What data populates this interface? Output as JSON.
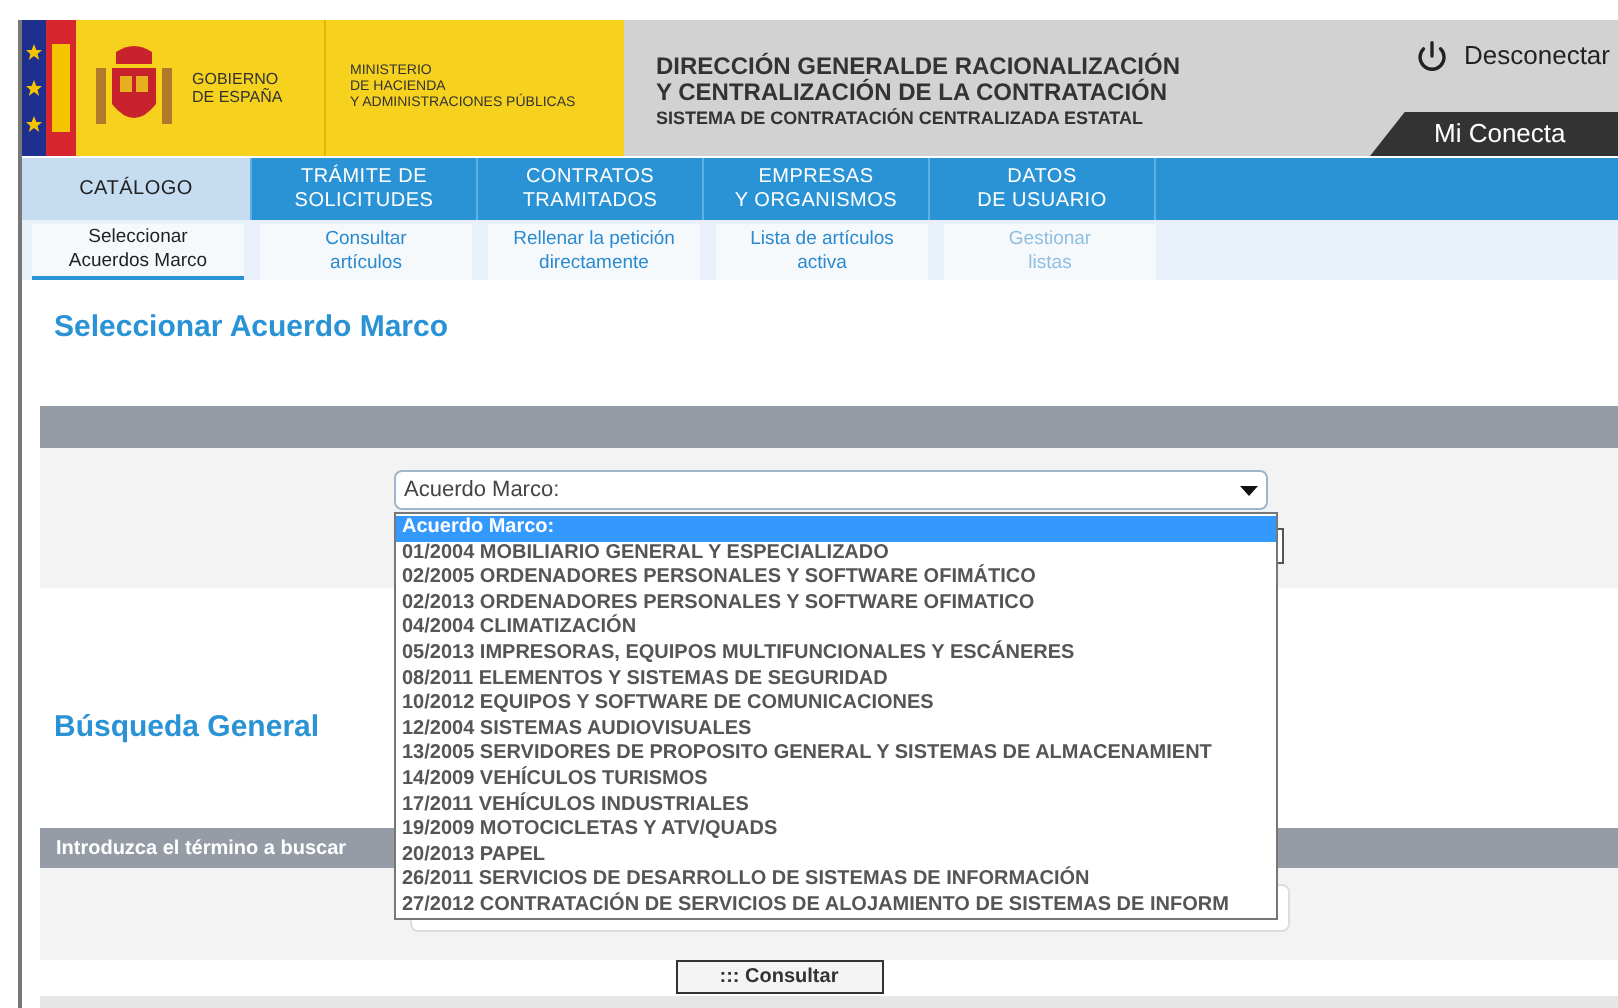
{
  "header": {
    "government": "GOBIERNO\nDE ESPAÑA",
    "ministry": "MINISTERIO\nDE HACIENDA\nY ADMINISTRACIONES PÚBLICAS",
    "title_lines": [
      "DIRECCIÓN GENERALDE RACIONALIZACIÓN",
      "Y CENTRALIZACIÓN DE LA CONTRATACIÓN"
    ],
    "subtitle": "SISTEMA DE CONTRATACIÓN CENTRALIZADA ESTATAL",
    "logout": "Desconectar",
    "account_tab": "Mi Conecta"
  },
  "main_tabs": [
    {
      "label": "CATÁLOGO",
      "selected": true
    },
    {
      "label": "TRÁMITE DE\nSOLICITUDES",
      "selected": false
    },
    {
      "label": "CONTRATOS\nTRAMITADOS",
      "selected": false
    },
    {
      "label": "EMPRESAS\nY ORGANISMOS",
      "selected": false
    },
    {
      "label": "DATOS\nDE USUARIO",
      "selected": false
    }
  ],
  "sub_tabs": [
    {
      "label": "Seleccionar\nAcuerdos Marco",
      "selected": true,
      "disabled": false
    },
    {
      "label": "Consultar\nartículos",
      "selected": false,
      "disabled": false
    },
    {
      "label": "Rellenar la petición\ndirectamente",
      "selected": false,
      "disabled": false
    },
    {
      "label": "Lista de artículos\nactiva",
      "selected": false,
      "disabled": false
    },
    {
      "label": "Gestionar\nlistas",
      "selected": false,
      "disabled": true
    }
  ],
  "select_section": {
    "title": "Seleccionar Acuerdo Marco",
    "select_value": "Acuerdo Marco:",
    "options": [
      {
        "label": "Acuerdo Marco:",
        "selected": true
      },
      {
        "label": "01/2004 MOBILIARIO GENERAL Y ESPECIALIZADO",
        "selected": false
      },
      {
        "label": "02/2005 ORDENADORES PERSONALES Y SOFTWARE OFIMÁTICO",
        "selected": false
      },
      {
        "label": "02/2013 ORDENADORES PERSONALES Y SOFTWARE OFIMATICO",
        "selected": false
      },
      {
        "label": "04/2004 CLIMATIZACIÓN",
        "selected": false
      },
      {
        "label": "05/2013 IMPRESORAS, EQUIPOS MULTIFUNCIONALES Y ESCÁNERES",
        "selected": false
      },
      {
        "label": "08/2011 ELEMENTOS Y SISTEMAS DE SEGURIDAD",
        "selected": false
      },
      {
        "label": "10/2012 EQUIPOS Y SOFTWARE DE COMUNICACIONES",
        "selected": false
      },
      {
        "label": "12/2004 SISTEMAS AUDIOVISUALES",
        "selected": false
      },
      {
        "label": "13/2005 SERVIDORES DE PROPOSITO GENERAL Y SISTEMAS DE ALMACENAMIENT",
        "selected": false
      },
      {
        "label": "14/2009 VEHÍCULOS TURISMOS",
        "selected": false
      },
      {
        "label": "17/2011 VEHÍCULOS INDUSTRIALES",
        "selected": false
      },
      {
        "label": "19/2009 MOTOCICLETAS Y ATV/QUADS",
        "selected": false
      },
      {
        "label": "20/2013 PAPEL",
        "selected": false
      },
      {
        "label": "26/2011 SERVICIOS DE DESARROLLO DE SISTEMAS DE INFORMACIÓN",
        "selected": false
      },
      {
        "label": "27/2012 CONTRATACIÓN DE SERVICIOS DE ALOJAMIENTO DE SISTEMAS DE INFORM",
        "selected": false
      }
    ]
  },
  "search_section": {
    "title": "Búsqueda General",
    "bar_label": "Introduzca el término a buscar",
    "button": "::: Consultar"
  }
}
